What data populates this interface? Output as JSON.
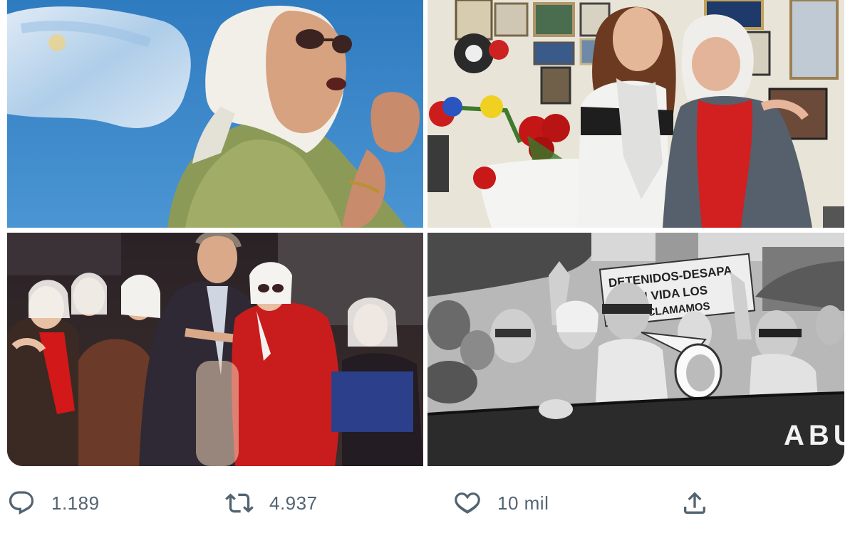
{
  "tweet": {
    "photos": [
      {
        "id": "photo-1",
        "banner_text": ""
      },
      {
        "id": "photo-2",
        "banner_text": ""
      },
      {
        "id": "photo-3",
        "banner_text": ""
      },
      {
        "id": "photo-4",
        "sign_line_1": "DETENIDOS-DESAPA",
        "sign_line_2": "CON VIDA LOS",
        "sign_line_3": "ESCLAMAMOS",
        "banner_text": "ABU"
      }
    ],
    "actions": {
      "reply": {
        "icon": "reply-icon",
        "count": "1.189"
      },
      "retweet": {
        "icon": "retweet-icon",
        "count": "4.937"
      },
      "like": {
        "icon": "heart-icon",
        "count": "10 mil"
      },
      "share": {
        "icon": "share-icon"
      }
    },
    "colors": {
      "icon_gray": "#536471",
      "sky_blue": "#3f87c8",
      "scarf_red": "#d01d1d"
    }
  }
}
